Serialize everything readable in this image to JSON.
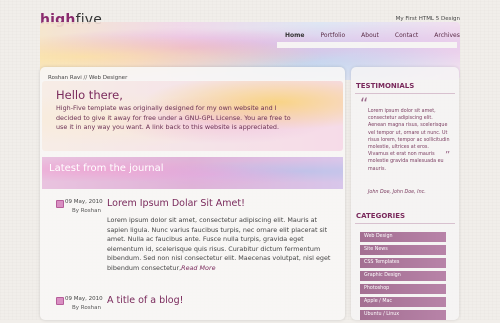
{
  "site": {
    "logo_part1": "high",
    "logo_part2": "five",
    "tagline": "My First HTML 5 Design"
  },
  "nav": {
    "items": [
      "Home",
      "Portfolio",
      "About",
      "Contact",
      "Archives"
    ],
    "active": "Home"
  },
  "breadcrumb": "Roshan Ravi // Web Designer",
  "hero": {
    "title": "Hello there,",
    "text": "High-Five template was originally designed for my own website and I decided to give it away for free under a GNU-GPL License. You are free to use it in any way you want. A link back to this website is appreciated."
  },
  "journal": {
    "title": "Latest from the journal",
    "posts": [
      {
        "date": "09 May, 2010",
        "byline": "By Roshan",
        "title": "Lorem Ipsum Dolar Sit Amet!",
        "body": "Lorem ipsum dolor sit amet, consectetur adipiscing elit. Mauris at sapien ligula. Nunc varius faucibus turpis, nec ornare elit placerat sit amet. Nulla ac faucibus ante. Fusce nulla turpis, gravida eget elementum id, scelerisque quis risus. Curabitur dictum fermentum bibendum. Sed non nisl consectetur elit. Maecenas volutpat, nisl eget bibendum consectetur,",
        "read_more": "Read More"
      },
      {
        "date": "09 May, 2010",
        "byline": "By Roshan",
        "title": "A title of a blog!"
      }
    ]
  },
  "sidebar": {
    "testimonials": {
      "title": "TESTIMONIALS",
      "quote_open": "“",
      "quote_close": "”",
      "text": "Lorem ipsum dolor sit amet, consectetur adipiscing elit. Aenean magna risus, scelerisque vel tempor ut, ornare ut nunc. Ut risus lorem, tempor ac sollicitudin molestie, ultrices at eros. Vivamus et erat non mauris molestie gravida malesuada eu mauris.",
      "author": "John Doe, John Doe, Inc."
    },
    "categories": {
      "title": "CATEGORIES",
      "items": [
        "Web Design",
        "Site News",
        "CSS Templates",
        "Graphic Design",
        "Photoshop",
        "Apple / Mac",
        "Ubuntu / Linux"
      ]
    }
  },
  "colors": {
    "accent": "#7a2a5c",
    "background": "#f1eeea",
    "category_bg": "#a36f92"
  },
  "icons": [
    "calendar-icon",
    "quote-icon"
  ]
}
